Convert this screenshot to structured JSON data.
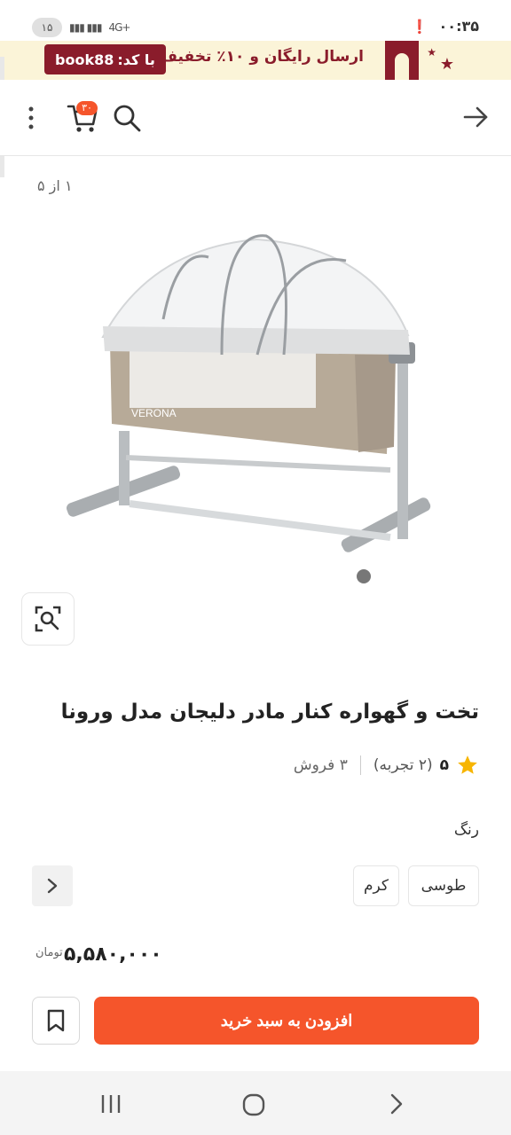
{
  "status_bar": {
    "time": "۰۰:۳۵",
    "battery": "۱۵",
    "network": "4G+"
  },
  "promo": {
    "text": "ارسال رایگان و ۱۰٪ تخفیف",
    "code_label": "با کد:",
    "code": "book88"
  },
  "header": {
    "cart_count": "۳۰"
  },
  "gallery": {
    "counter": "۱ از ۵"
  },
  "product": {
    "title": "تخت و گهواره کنار مادر دلیجان مدل ورونا",
    "rating": "۵",
    "rating_count": "(۲ تجربه)",
    "sales": "۳ فروش",
    "color_label": "رنگ",
    "colors": [
      "طوسی",
      "کرم"
    ],
    "price": "۵,۵۸۰,۰۰۰",
    "currency": "تومان",
    "image_brand": "VERONA"
  },
  "actions": {
    "add_to_cart": "افزودن به سبد خرید"
  },
  "theme": {
    "accent": "#f5552b",
    "promo_bg": "#fbf4d8",
    "promo_brand": "#8a1c2b",
    "star": "#f7b500"
  }
}
